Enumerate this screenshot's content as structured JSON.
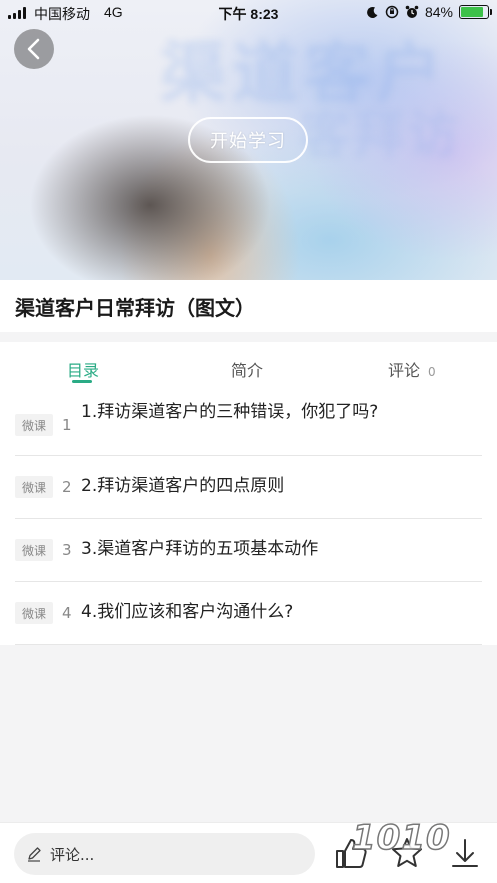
{
  "status_bar": {
    "carrier": "中国移动",
    "network": "4G",
    "time": "下午 8:23",
    "battery": "84%",
    "battery_level": 0.84
  },
  "hero": {
    "start_label": "开始学习",
    "blur_text_1": "渠道客户",
    "blur_text_2": "客拜访"
  },
  "course": {
    "title": "渠道客户日常拜访（图文）"
  },
  "tabs": [
    {
      "label": "目录"
    },
    {
      "label": "简介"
    },
    {
      "label": "评论",
      "count": "0"
    }
  ],
  "lessons": [
    {
      "badge": "微课",
      "num": "1",
      "title": "1.拜访渠道客户的三种错误，你犯了吗?"
    },
    {
      "badge": "微课",
      "num": "2",
      "title": "2.拜访渠道客户的四点原则"
    },
    {
      "badge": "微课",
      "num": "3",
      "title": "3.渠道客户拜访的五项基本动作"
    },
    {
      "badge": "微课",
      "num": "4",
      "title": "4.我们应该和客户沟通什么?"
    }
  ],
  "bottom": {
    "comment_placeholder": "评论...",
    "icons": [
      "edit-icon",
      "thumbs-up-icon",
      "star-icon",
      "download-icon"
    ],
    "watermark": "1010"
  },
  "colors": {
    "accent": "#2aab85",
    "battery_fill": "#3ec14a"
  }
}
